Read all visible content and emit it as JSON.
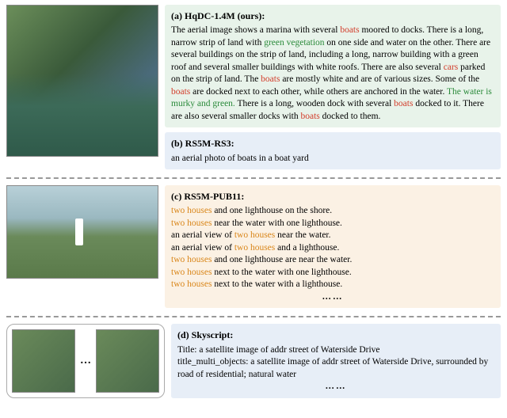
{
  "a": {
    "title": "(a) HqDC-1.4M (ours):",
    "t0": "The aerial image shows a marina with several ",
    "b1": "boats",
    "t1": " moored to docks. There is a long, narrow strip of land with ",
    "g1": "green vegetation",
    "t2": " on one side and water on the other. There are several buildings on the strip of land, including a long, narrow building with a green roof and several smaller buildings with white roofs. There are also several ",
    "c1": "cars",
    "t3": " parked on the strip of land. The ",
    "b2": "boats",
    "t4": " are mostly white and are of various sizes. Some of the ",
    "b3": "boats",
    "t5": " are docked next to each other, while others are anchored in the water. ",
    "g2": "The water is murky and green.",
    "t6": " There is a long, wooden dock with several ",
    "b4": "boats",
    "t7": " docked to it. There are also several smaller docks with ",
    "b5": "boats",
    "t8": " docked to them."
  },
  "b": {
    "title": "(b) RS5M-RS3:",
    "text": "an aerial photo of boats in a boat yard"
  },
  "c": {
    "title": "(c) RS5M-PUB11:",
    "lines": [
      {
        "h": "two houses",
        "rest": " and one lighthouse on the shore."
      },
      {
        "h": "two houses",
        "rest": " near the water with one lighthouse."
      },
      {
        "pre": "an aerial view of ",
        "h": "two houses",
        "rest": " near the water."
      },
      {
        "pre": "an aerial view of ",
        "h": "two houses",
        "rest": " and a lighthouse."
      },
      {
        "h": "two houses",
        "rest": " and one lighthouse are near the water."
      },
      {
        "h": "two houses",
        "rest": " next to the water with one lighthouse."
      },
      {
        "h": "two houses",
        "rest": " next to the water with a lighthouse."
      }
    ],
    "ellipsis": "……"
  },
  "d": {
    "title": "(d) Skyscript:",
    "line1": "Title: a satellite image of addr street of Waterside Drive",
    "line2": "title_multi_objects: a satellite image of addr street of Waterside Drive, surrounded by road of residential; natural water",
    "ellipsis": "……",
    "pair_dots": "…"
  }
}
